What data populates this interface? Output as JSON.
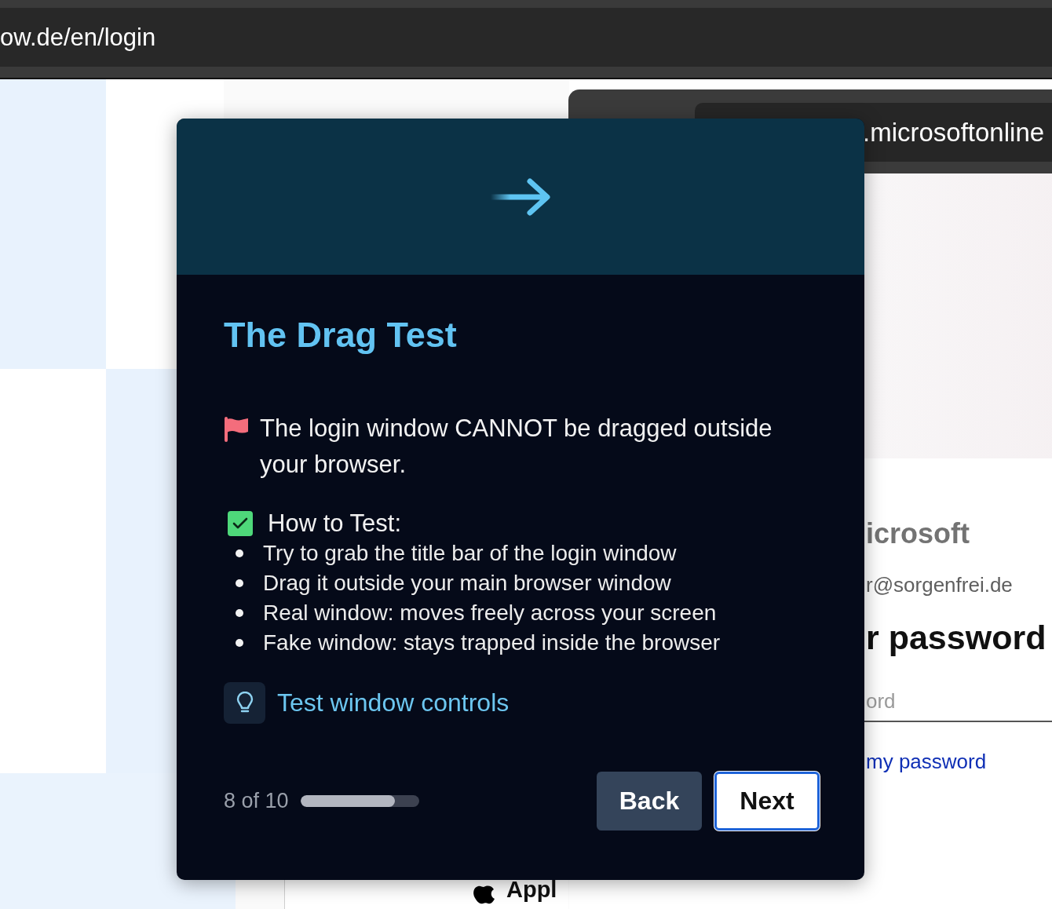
{
  "browser": {
    "url": "ow.de/en/login"
  },
  "popup_window": {
    "url": ".microsoftonline",
    "brand": "icrosoft",
    "account": "r@sorgenfrei.de",
    "heading": "r password",
    "password_field": {
      "placeholder": "ord"
    },
    "link": "my password"
  },
  "page": {
    "apple_button": "Appl"
  },
  "modal": {
    "title": "The Drag Test",
    "warning": "The login window CANNOT be dragged outside your browser.",
    "how_to": {
      "heading": "How to Test:",
      "checked": true,
      "steps": [
        "Try to grab the title bar of the login window",
        "Drag it outside your main browser window",
        "Real window: moves freely across your screen",
        "Fake window: stays trapped inside the browser"
      ]
    },
    "link": "Test window controls",
    "progress": {
      "label": "8 of 10",
      "level": 0.8
    },
    "buttons": [
      {
        "label": "Back",
        "kind": "secondary",
        "focused": false
      },
      {
        "label": "Next",
        "kind": "primary",
        "focused": true
      }
    ]
  }
}
